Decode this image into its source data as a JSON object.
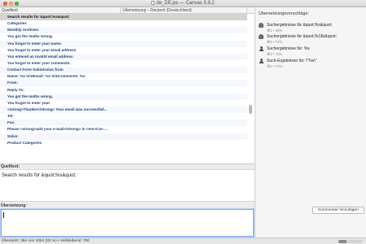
{
  "window": {
    "title": "de_DE.po",
    "app": "Canvas 5.9.2"
  },
  "list": {
    "col_source": "Quelltext",
    "col_target": "Übersetzung – Deutsch (Deutschland)",
    "rows": [
      "Search results for &quot;%s&quot;",
      "Categories",
      "Monthly Archives",
      "You got the maths wrong.",
      "You forgot to enter your name.",
      "You forgot to enter your email address.",
      "You entered an invalid email address.",
      "You forgot to enter your comments.",
      "Contact Form Submission from",
      "Name: %s \\n\\nEmail: %s \\n\\nComments: %s",
      "From:",
      "Reply-To:",
      "You got the maths wrong.",
      "You forgot to enter your",
      "<strong>Thanks!</strong> Your email was successfull...",
      "Tel:",
      "Fax:",
      "Please <strong>add your e-mail</strong> in <em>Con ...",
      "Solve:",
      "Product Categories"
    ]
  },
  "sidebar": {
    "title": "Übersetzungsvorschläge:",
    "suggestions": [
      {
        "icon": "database-icon",
        "text": "Suchergebnisse für &quot;%s&quot;",
        "meta": "⌘1 • 95%"
      },
      {
        "icon": "database-icon",
        "text": "Suchergebnisse für &quot;%1$s&quot;",
        "meta": "⌘2 • 74%"
      },
      {
        "icon": "person-icon",
        "text": "Suchergebnisse für: %s",
        "meta": "⌘3 • 73%"
      },
      {
        "icon": "person-icon",
        "text": "Such-Ergebnisse für: \\\"%s\\\"",
        "meta": "⌘4 • 71%"
      }
    ],
    "comment_button": "Kommentar hinzufügen"
  },
  "source": {
    "label": "Quelltext:",
    "text": "Search results for &quot;%s&quot;"
  },
  "translation": {
    "label": "Übersetzung:",
    "value": ""
  },
  "status": {
    "text": "Übersetzt: 364 von 1054 (33 %) • Verbleibend: 700",
    "progress": 0.33
  }
}
